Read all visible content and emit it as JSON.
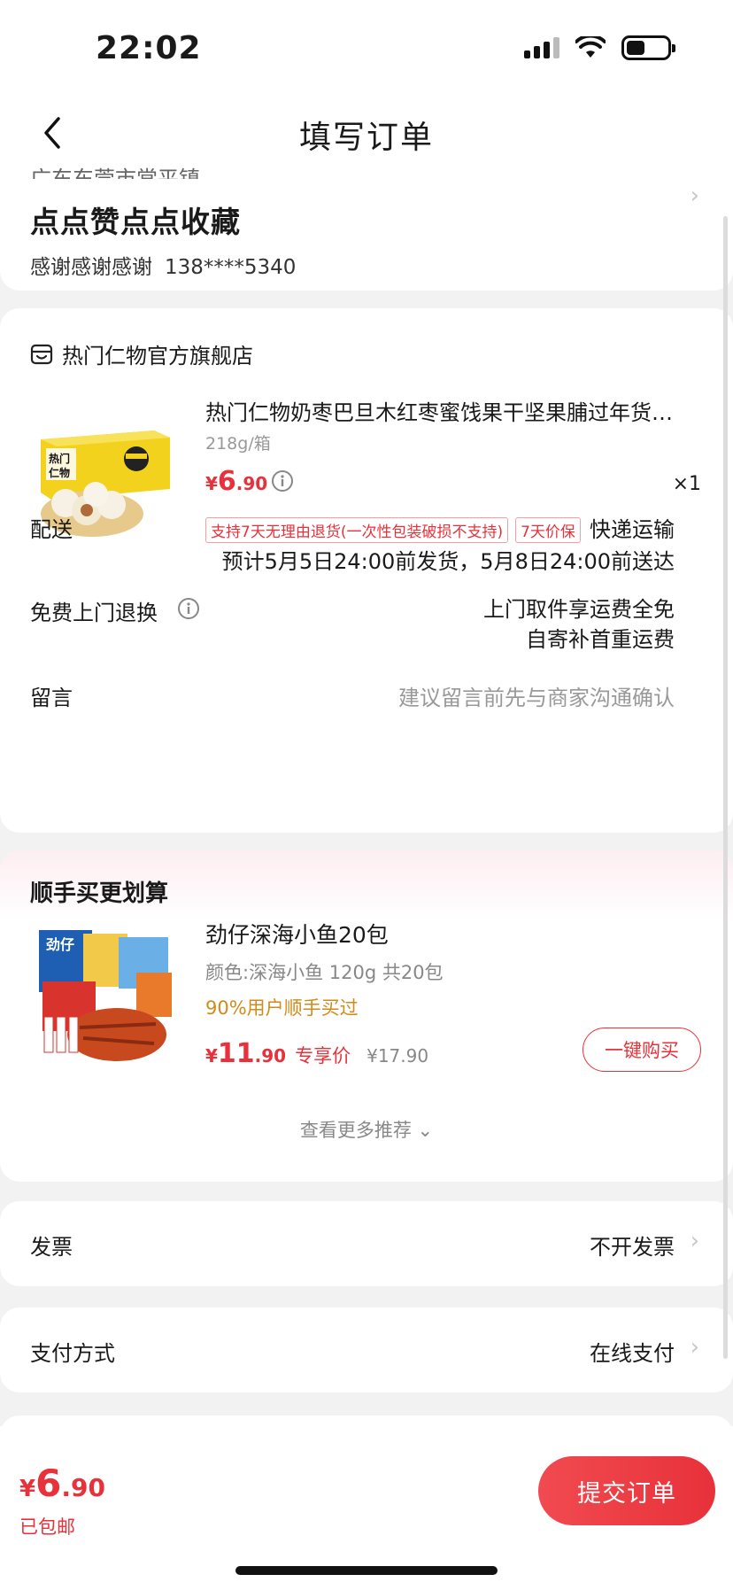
{
  "status_bar": {
    "time": "22:02"
  },
  "nav": {
    "title": "填写订单"
  },
  "address": {
    "region": "广东东莞市常平镇",
    "title": "点点赞点点收藏",
    "name": "感谢感谢感谢",
    "phone": "138****5340"
  },
  "store": {
    "name": "热门仁物官方旗舰店"
  },
  "product": {
    "title": "热门仁物奶枣巴旦木红枣蜜饯果干坚果脯过年货…",
    "spec": "218g/箱",
    "price_currency": "¥",
    "price_int": "6",
    "price_dec": ".90",
    "qty": "×1",
    "tags": [
      "支持7天无理由退货(一次性包装破损不支持)",
      "7天价保"
    ]
  },
  "delivery": {
    "label": "配送",
    "method": "快递运输",
    "estimate": "预计5月5日24:00前发货，5月8日24:00前送达"
  },
  "returns": {
    "label": "免费上门退换",
    "line1": "上门取件享运费全免",
    "line2": "自寄补首重运费"
  },
  "message": {
    "label": "留言",
    "placeholder": "建议留言前先与商家沟通确认"
  },
  "recommend": {
    "title": "顺手买更划算",
    "item_name": "劲仔深海小鱼20包",
    "item_spec": "颜色:深海小鱼 120g 共20包",
    "popularity": "90%用户顺手买过",
    "price_currency": "¥",
    "price_int": "11",
    "price_dec": ".90",
    "exclusive_label": "专享价",
    "original_price": "¥17.90",
    "buy_label": "一键购买",
    "more_label": "查看更多推荐 ⌄"
  },
  "invoice": {
    "label": "发票",
    "value": "不开发票"
  },
  "payment": {
    "label": "支付方式",
    "value": "在线支付"
  },
  "footer": {
    "currency": "¥",
    "total_int": "6",
    "total_dec": ".90",
    "shipping_note": "已包邮",
    "submit_label": "提交订单"
  },
  "colors": {
    "accent": "#e8313a",
    "popularity": "#d28a1a",
    "background": "#f2f2f2"
  },
  "icons": [
    "back-icon",
    "chevron-right-icon",
    "store-icon",
    "info-icon",
    "signal-icon",
    "wifi-icon",
    "battery-icon"
  ]
}
